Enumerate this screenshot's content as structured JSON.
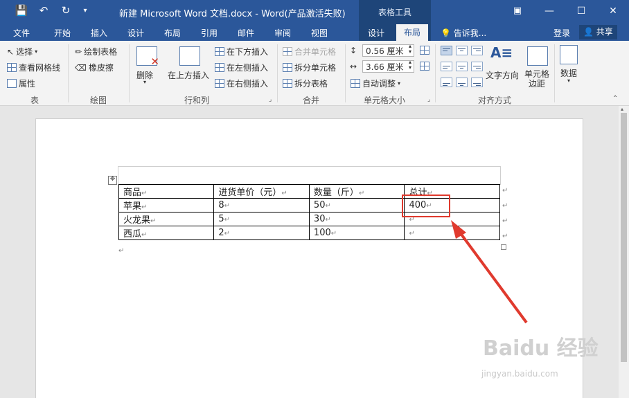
{
  "window": {
    "title": "新建 Microsoft Word 文档.docx - Word(产品激活失败)",
    "context_tab_group": "表格工具"
  },
  "tabs": [
    "文件",
    "开始",
    "插入",
    "设计",
    "布局",
    "引用",
    "邮件",
    "审阅",
    "视图",
    "设计",
    "布局"
  ],
  "active_tab": "布局",
  "tell_me": "告诉我...",
  "login": "登录",
  "share": "共享",
  "ribbon": {
    "table_group": {
      "label": "表",
      "items": [
        "选择",
        "查看网格线",
        "属性"
      ]
    },
    "draw_group": {
      "label": "绘图",
      "items": [
        "绘制表格",
        "橡皮擦"
      ]
    },
    "rows_cols_group": {
      "label": "行和列",
      "delete": "删除",
      "insert_above": "在上方插入",
      "insert_below": "在下方插入",
      "insert_left": "在左侧插入",
      "insert_right": "在右侧插入"
    },
    "merge_group": {
      "label": "合并",
      "items": [
        "合并单元格",
        "拆分单元格",
        "拆分表格"
      ]
    },
    "cell_size_group": {
      "label": "单元格大小",
      "height": "0.56 厘米",
      "width": "3.66 厘米",
      "autofit": "自动调整"
    },
    "alignment_group": {
      "label": "对齐方式",
      "text_direction": "文字方向",
      "cell_margins": "单元格边距"
    },
    "data_group": {
      "label": "数据"
    }
  },
  "document": {
    "table": {
      "rows": [
        [
          "商品",
          "进货单价（元）",
          "数量（斤）",
          "总计"
        ],
        [
          "苹果",
          "8",
          "50",
          "400"
        ],
        [
          "火龙果",
          "5",
          "30",
          ""
        ],
        [
          "西瓜",
          "2",
          "100",
          ""
        ]
      ]
    }
  },
  "watermark": {
    "brand": "Baidu 经验",
    "url": "jingyan.baidu.com"
  },
  "colors": {
    "accent": "#2b579a",
    "annotation": "#e03a2e"
  }
}
